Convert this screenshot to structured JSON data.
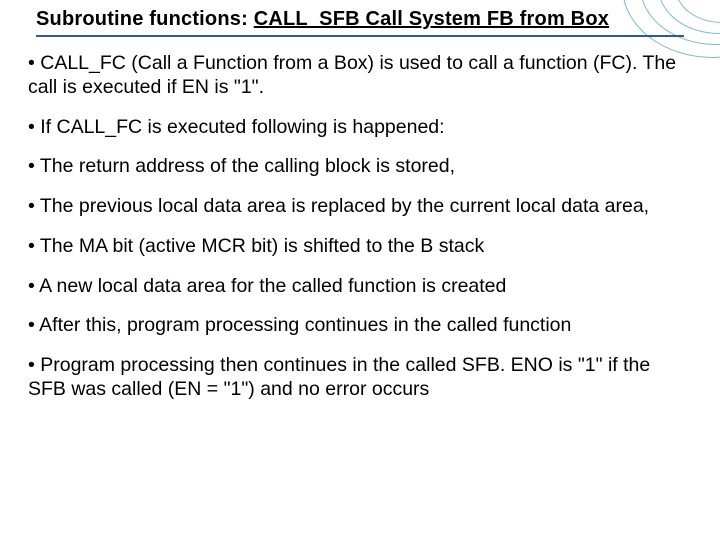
{
  "title": {
    "plain": "Subroutine functions: ",
    "underlined": "CALL_SFB Call System FB from Box"
  },
  "bullets": [
    "• CALL_FC (Call a Function from a Box) is used to call a function (FC).  The call is executed if EN is \"1\".",
    "• If CALL_FC is executed following is happened:",
    "• The return address of the calling block is stored,",
    "• The previous local data area is replaced by the current local data area,",
    "• The MA bit (active MCR bit) is shifted to the B stack",
    "• A new local data area for the called function is created",
    "• After this, program processing continues in the called function",
    "• Program processing then continues in the called SFB. ENO is \"1\" if the SFB was called (EN = \"1\") and no error occurs"
  ]
}
